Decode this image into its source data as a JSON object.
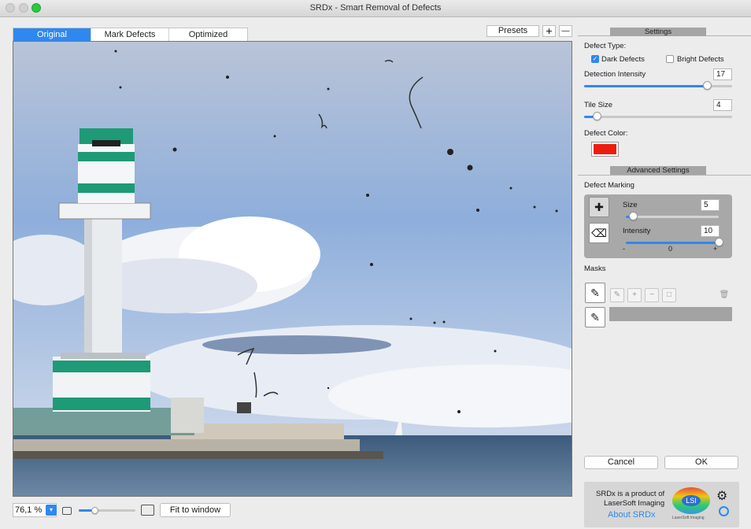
{
  "window": {
    "title": "SRDx - Smart Removal of Defects"
  },
  "tabs": [
    {
      "label": "Original",
      "active": true
    },
    {
      "label": "Mark Defects",
      "active": false
    },
    {
      "label": "Optimized",
      "active": false
    }
  ],
  "toolbar": {
    "presets_label": "Presets",
    "add_label": "+",
    "remove_label": "—"
  },
  "bottom": {
    "zoom_value": "76,1 %",
    "zoom_slider_value": 0.28,
    "fit_label": "Fit to window"
  },
  "settings": {
    "header": "Settings",
    "defect_type_label": "Defect Type:",
    "dark_defects_label": "Dark Defects",
    "dark_defects_checked": true,
    "bright_defects_label": "Bright Defects",
    "bright_defects_checked": false,
    "detection_intensity_label": "Detection Intensity",
    "detection_intensity_value": "17",
    "detection_intensity_fraction": 0.83,
    "tile_size_label": "Tile Size",
    "tile_size_value": "4",
    "tile_size_fraction": 0.09,
    "defect_color_label": "Defect Color:",
    "defect_color": "#ee1c0e"
  },
  "advanced": {
    "header": "Advanced Settings",
    "defect_marking_label": "Defect Marking",
    "size_label": "Size",
    "size_value": "5",
    "size_fraction": 0.08,
    "intensity_label": "Intensity",
    "intensity_value": "10",
    "intensity_fraction": 1.0,
    "scale_min": "-",
    "scale_mid": "0",
    "scale_max": "+",
    "masks_label": "Masks"
  },
  "actions": {
    "cancel_label": "Cancel",
    "ok_label": "OK"
  },
  "promo": {
    "line1": "SRDx is a product of",
    "line2": "LaserSoft Imaging",
    "link": "About SRDx",
    "logo_text": "LSI",
    "logo_caption": "LaserSoft Imaging"
  },
  "icons": {
    "gear": "gear-icon",
    "help": "help-icon",
    "brush": "add-defect-brush-icon",
    "eraser": "eraser-icon",
    "mask_pen": "mask-pen-icon",
    "mask_pen2": "mask-pen-alt-icon",
    "trash": "trash-icon"
  },
  "colors": {
    "accent": "#2e88f0",
    "link": "#2e88f0"
  }
}
